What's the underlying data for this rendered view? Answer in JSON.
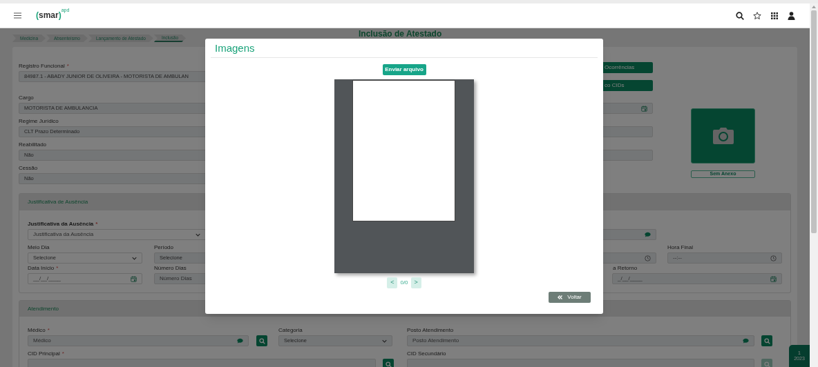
{
  "header": {
    "logo": "(smar)",
    "logo_superscript": "apd"
  },
  "breadcrumb": [
    {
      "label": "Medicina",
      "selected": false
    },
    {
      "label": "Absenteísmo",
      "selected": false
    },
    {
      "label": "Lançamento de Atestado",
      "selected": false
    },
    {
      "label": "Inclusão",
      "selected": true
    }
  ],
  "page_title": "Inclusão de Atestado",
  "employee_fields": [
    {
      "label": "Registro Funcional",
      "required_mark": "*",
      "value": "84987.1 - ABADY JUNIOR DE OLIVEIRA - MOTORISTA DE AMBULAN"
    },
    {
      "label": "Cargo",
      "value": "MOTORISTA DE AMBULANCIA"
    },
    {
      "label": "Regime Jurídico",
      "value": "CLT Prazo Determinado"
    },
    {
      "label": "Reabilitado",
      "value": "Não"
    },
    {
      "label": "Cessão",
      "value": "Não"
    }
  ],
  "side_buttons": [
    "Ocorrências",
    "co CIDs"
  ],
  "attachment": {
    "status": "Sem Anexo"
  },
  "absence": {
    "title": "Justificativa de Ausência",
    "reason": {
      "label": "Justificativa da Ausência",
      "required_mark": "*",
      "placeholder": "Justificativa da Ausência"
    },
    "half_day": {
      "label": "Meio Dia",
      "value": "Selecione"
    },
    "period": {
      "label": "Período",
      "value": "Selecione"
    },
    "end_time": {
      "label": "Hora Final",
      "placeholder": "--:--"
    },
    "start_date": {
      "label": "Data Início",
      "required_mark": "*",
      "placeholder": "__/__/____"
    },
    "days": {
      "label": "Número Dias",
      "placeholder": "Número Dias"
    },
    "return_date": {
      "label": "a Retorno",
      "placeholder": "_/__/____"
    }
  },
  "attendance": {
    "title": "Atendimento",
    "doctor": {
      "label": "Médico",
      "required_mark": "*",
      "placeholder": "Médico"
    },
    "category": {
      "label": "Categoria",
      "value": "Selecione"
    },
    "post": {
      "label": "Posto Atendimento",
      "placeholder": "Posto Atendimento"
    },
    "cid_main": {
      "label": "CID Principal",
      "required_mark": "*"
    },
    "cid_secondary": {
      "label": "CID Secundário"
    }
  },
  "period_badge": {
    "month": "1",
    "year": "2023"
  },
  "modal": {
    "title": "Imagens",
    "upload_button": "Enviar arquivo",
    "pager": {
      "prev": "<",
      "count": "0/0",
      "next": ">",
      "disabled": true
    },
    "back_button": "Voltar"
  }
}
